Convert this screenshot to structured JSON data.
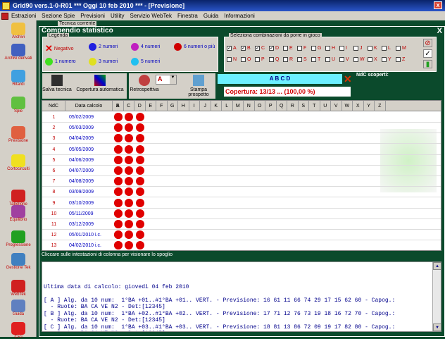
{
  "app": {
    "title": "Grid90 vers.1-0-R01  ***  Oggi 10 feb 2010  ***  - [Previsione]"
  },
  "menu": [
    "Estrazioni",
    "Sezione Spie",
    "Previsioni",
    "Utility",
    "Servizio WebTek",
    "Finestra",
    "Guida",
    "Informazioni"
  ],
  "sidebar": [
    {
      "label": "Archivi",
      "color": "#f0c040"
    },
    {
      "label": "Archivi derivati",
      "color": "#4060c0"
    },
    {
      "label": "Ritardi",
      "color": "#40a0e0"
    },
    {
      "label": "Spie",
      "color": "#60c040"
    },
    {
      "label": "Previsione",
      "color": "#e06040"
    },
    {
      "label": "Cortocircuiti",
      "color": "#f0e020"
    },
    {
      "label": "Tabellone",
      "color": "#d02020"
    },
    {
      "label": "Equilibrio",
      "color": "#a040a0"
    },
    {
      "label": "Progressione",
      "color": "#20a020"
    },
    {
      "label": "Gestione Tek",
      "color": "#4080c0"
    },
    {
      "label": "WebTek",
      "color": "#d02020"
    },
    {
      "label": "Guida",
      "color": "#6080c0"
    },
    {
      "label": "Esci",
      "color": "#e02020"
    }
  ],
  "hidden_tab": "Tecnica corrente",
  "window": {
    "title": "Compendio statistico",
    "close": "X"
  },
  "legend": {
    "title": "Legenda",
    "items": [
      {
        "label": "Negativo",
        "color": "#e00000",
        "shape": "x"
      },
      {
        "label": "2 numeri",
        "color": "#2020e0"
      },
      {
        "label": "4 numeri",
        "color": "#c020c0"
      },
      {
        "label": "6 numeri o più",
        "color": "#d00000"
      },
      {
        "label": "1 numero",
        "color": "#40e020"
      },
      {
        "label": "3 numeri",
        "color": "#e0e020"
      },
      {
        "label": "5 numeri",
        "color": "#20c0f0"
      }
    ]
  },
  "combo": {
    "title": "Seleziona combinazioni da porre in gioco",
    "letters": [
      "A",
      "B",
      "C",
      "D",
      "E",
      "F",
      "G",
      "H",
      "I",
      "J",
      "K",
      "L",
      "M",
      "N",
      "O",
      "P",
      "Q",
      "R",
      "S",
      "T",
      "U",
      "V",
      "W",
      "X",
      "Y",
      "Z"
    ],
    "checked": [
      "A",
      "B",
      "C",
      "D"
    ]
  },
  "toolbar": {
    "salva": "Salva tecnica",
    "copertura": "Copertura automatica",
    "retro": "Retrospettiva",
    "retro_value": "A",
    "stampa": "Stampa prospetto"
  },
  "abcd": "A B C D",
  "ndc_label": "NdC scoperti:",
  "copertura": "Copertura: 13/13 ... (100,00 %)",
  "grid": {
    "headers": [
      "NdC",
      "Data calcolo",
      "A",
      "B",
      "C",
      "D",
      "E",
      "F",
      "G",
      "H",
      "I",
      "J",
      "K",
      "L",
      "M",
      "N",
      "O",
      "P",
      "Q",
      "R",
      "S",
      "T",
      "U",
      "V",
      "W",
      "X",
      "Y",
      "Z"
    ],
    "rows": [
      [
        "1",
        "05/02/2009"
      ],
      [
        "2",
        "05/03/2009"
      ],
      [
        "3",
        "04/04/2009"
      ],
      [
        "4",
        "05/05/2009"
      ],
      [
        "5",
        "04/06/2009"
      ],
      [
        "6",
        "04/07/2009"
      ],
      [
        "7",
        "04/08/2009"
      ],
      [
        "8",
        "03/09/2009"
      ],
      [
        "9",
        "03/10/2009"
      ],
      [
        "10",
        "05/11/2009"
      ],
      [
        "11",
        "03/12/2009"
      ],
      [
        "12",
        "05/01/2010 i.c."
      ],
      [
        "13",
        "04/02/2010 i.c."
      ]
    ]
  },
  "hint": "Cliccare sulle intestazioni di colonna per visionare lo spoglio",
  "output": [
    "Ultima data di calcolo: giovedì 04 feb 2010",
    "",
    "[ A ] Alg. da 10 num:  1°BA +01..#1°BA +01.. VERT. - Previsione: 16 61 11 66 74 29 17 15 62 60 - Capog.:",
    "  - Ruote: BA CA VE N2 - Det:[12345]",
    "[ B ] Alg. da 10 num:  1°BA +02..#1°BA +02.. VERT. - Previsione: 17 71 12 76 73 19 18 16 72 70 - Capog.:",
    "  - Ruote: BA CA VE N2 - Det:[12345]",
    "[ C ] Alg. da 10 num:  1°BA +03..#1°BA +03.. VERT. - Previsione: 18 81 13 86 72 09 19 17 82 80 - Capog.:",
    "  - Ruote: BA CA VE N2 - Det:[12345]"
  ]
}
